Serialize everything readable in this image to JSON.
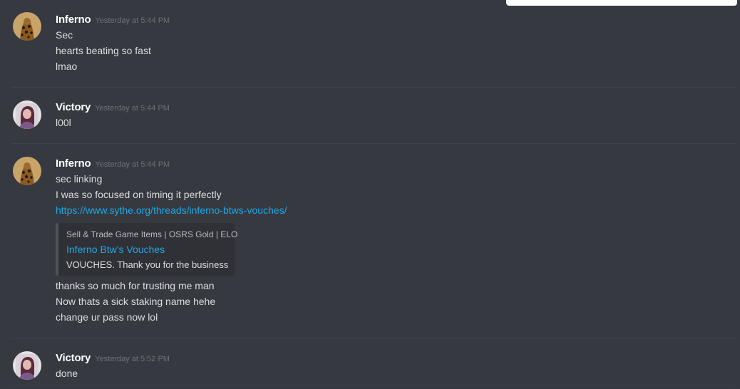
{
  "messages": [
    {
      "username": "Inferno",
      "timestamp": "Yesterday at 5:44 PM",
      "lines": [
        "Sec",
        "hearts beating so fast",
        "lmao"
      ]
    },
    {
      "username": "Victory",
      "timestamp": "Yesterday at 5:44 PM",
      "lines": [
        "l00l"
      ]
    },
    {
      "username": "Inferno",
      "timestamp": "Yesterday at 5:44 PM",
      "lines": [
        "sec linking",
        "I was so focused on timing it perfectly"
      ],
      "link": "https://www.sythe.org/threads/inferno-btws-vouches/",
      "embed": {
        "provider": "Sell & Trade Game Items | OSRS Gold | ELO",
        "title": "Inferno Btw's Vouches",
        "description": "VOUCHES. Thank you for the business"
      },
      "lines_after": [
        "thanks so much for trusting me man",
        "Now thats a sick staking name hehe",
        "change ur pass now lol"
      ]
    },
    {
      "username": "Victory",
      "timestamp": "Yesterday at 5:52 PM",
      "lines": [
        "done"
      ]
    }
  ],
  "colors": {
    "background": "#36393f",
    "username": "#ffffff",
    "timestamp": "#6e7177",
    "text": "#dcddde",
    "link": "#1ea7e8",
    "embed_bg": "#2f3136"
  }
}
